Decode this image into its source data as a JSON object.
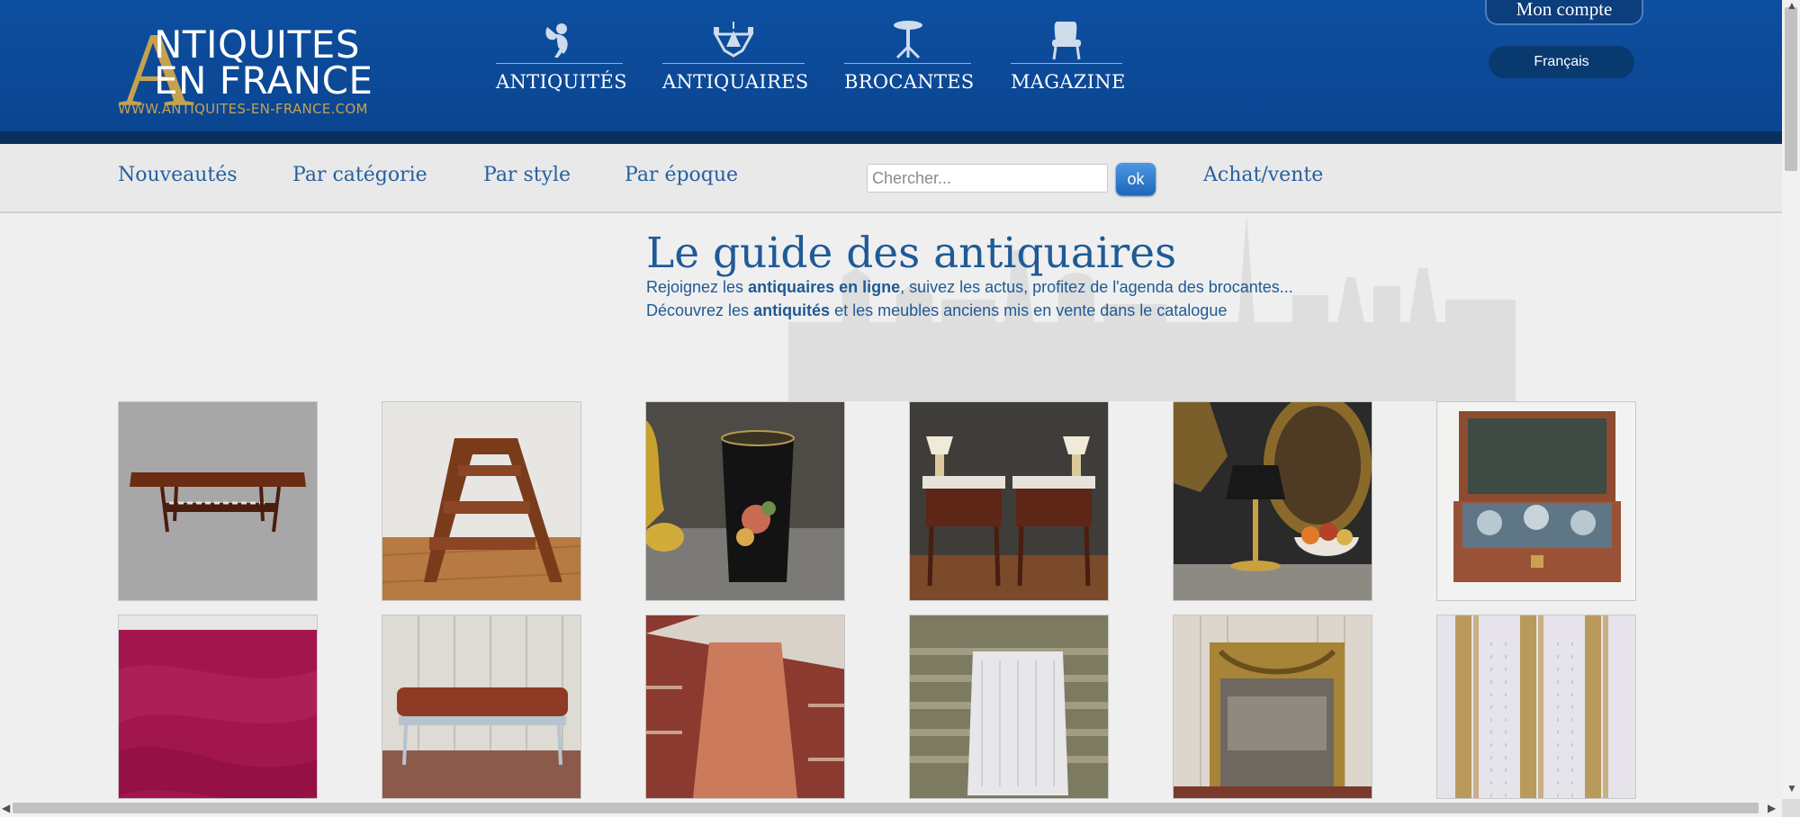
{
  "logo": {
    "big_letter": "A",
    "line1": "NTIQUITES",
    "line2": "EN FRANCE",
    "url": "WWW.ANTIQUITES-EN-FRANCE.COM"
  },
  "main_nav": [
    {
      "label": "ANTIQUITÉS",
      "icon": "cherub-icon"
    },
    {
      "label": "ANTIQUAIRES",
      "icon": "chandelier-icon"
    },
    {
      "label": "BROCANTES",
      "icon": "gueridon-table-icon"
    },
    {
      "label": "MAGAZINE",
      "icon": "armchair-icon"
    }
  ],
  "account": {
    "label": "Mon compte"
  },
  "language": {
    "label": "Français"
  },
  "sub_nav": {
    "links": [
      "Nouveautés",
      "Par catégorie",
      "Par style",
      "Par époque"
    ],
    "search_placeholder": "Chercher...",
    "search_button": "ok",
    "buy_sell": "Achat/vente"
  },
  "hero": {
    "title": "Le guide des antiquaires",
    "line1_pre": "Rejoignez les ",
    "line1_bold": "antiquaires en ligne",
    "line1_post": ", suivez les actus, profitez de l'agenda des brocantes...",
    "line2_pre": "Découvrez les ",
    "line2_bold": "antiquités",
    "line2_post": " et les meubles anciens mis en vente dans le catalogue"
  },
  "products": [
    {
      "subject": "coffee-table-image"
    },
    {
      "subject": "library-step-ladder-image"
    },
    {
      "subject": "painted-tole-waste-bin-image"
    },
    {
      "subject": "pair-of-bedside-tables-image"
    },
    {
      "subject": "bouillotte-lamp-image"
    },
    {
      "subject": "travel-necessaire-box-image"
    },
    {
      "subject": "pink-velvet-fabric-image"
    },
    {
      "subject": "footstool-image"
    },
    {
      "subject": "velvet-bench-image"
    },
    {
      "subject": "upholstered-seat-image"
    },
    {
      "subject": "gilt-trumeau-mirror-image"
    },
    {
      "subject": "striped-fabric-image"
    }
  ],
  "colors": {
    "header_blue": "#0e4fa0",
    "gold": "#c6a24f",
    "link_blue": "#25609f"
  }
}
